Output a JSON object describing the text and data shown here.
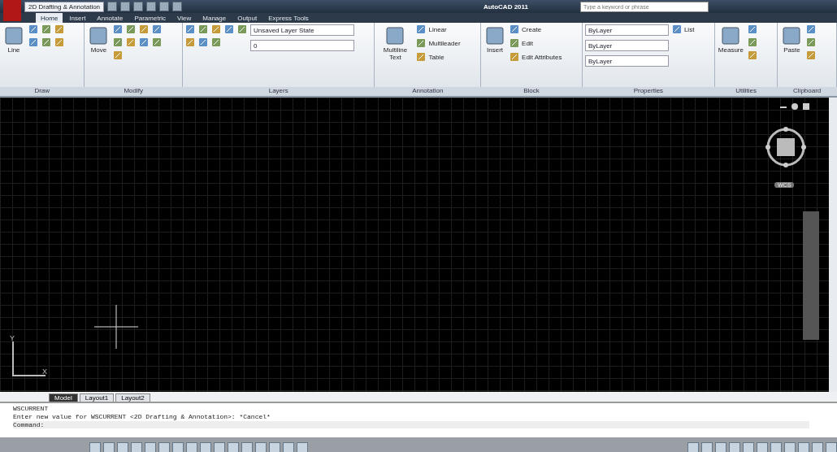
{
  "title_bar": {
    "workspace": "2D Drafting & Annotation",
    "title": "AutoCAD 2011",
    "search": {
      "placeholder": "Type a keyword or phrase"
    }
  },
  "ribbon_tabs": [
    {
      "label": "Home",
      "selected": true
    },
    {
      "label": "Insert",
      "selected": false
    },
    {
      "label": "Annotate",
      "selected": false
    },
    {
      "label": "Parametric",
      "selected": false
    },
    {
      "label": "View",
      "selected": false
    },
    {
      "label": "Manage",
      "selected": false
    },
    {
      "label": "Output",
      "selected": false
    },
    {
      "label": "Express Tools",
      "selected": false
    }
  ],
  "panels": [
    {
      "title": "Draw",
      "large": [
        "Line"
      ]
    },
    {
      "title": "Modify",
      "large": [
        "Move"
      ]
    },
    {
      "title": "Layers",
      "dropdowns": [
        "Unsaved Layer State",
        "0"
      ]
    },
    {
      "title": "Annotation",
      "large": [
        "Multiline Text"
      ],
      "small": [
        "Linear",
        "Multileader",
        "Table"
      ]
    },
    {
      "title": "Block",
      "large": [
        "Insert"
      ],
      "small": [
        "Create",
        "Edit",
        "Edit Attributes"
      ]
    },
    {
      "title": "Properties",
      "small": [
        "List"
      ],
      "dropdowns": [
        "ByLayer",
        "ByLayer",
        "ByLayer"
      ]
    },
    {
      "title": "Utilities",
      "large": [
        "Measure"
      ]
    },
    {
      "title": "Clipboard",
      "large": [
        "Paste"
      ]
    }
  ],
  "viewport": {
    "cube_label": "WCS",
    "axis_x": "X",
    "axis_y": "Y"
  },
  "layout_tabs": [
    {
      "label": "Model",
      "selected": true
    },
    {
      "label": "Layout1",
      "selected": false
    },
    {
      "label": "Layout2",
      "selected": false
    }
  ],
  "command_history": [
    "WSCURRENT",
    "Enter new value for WSCURRENT <2D Drafting & Annotation>: *Cancel*"
  ],
  "command_prompt": "Command:"
}
